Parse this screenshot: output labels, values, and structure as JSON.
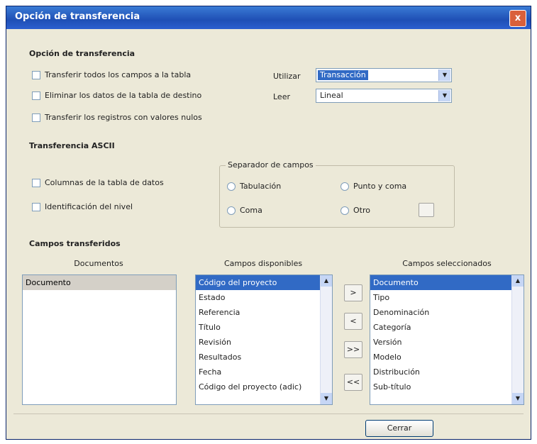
{
  "window": {
    "title": "Opción de transferencia",
    "close_label": "x"
  },
  "options_section": {
    "title": "Opción de transferencia",
    "checks": [
      {
        "label": "Transferir todos los campos a la tabla"
      },
      {
        "label": "Eliminar los datos de la tabla de destino"
      },
      {
        "label": "Transferir los registros con valores nulos"
      }
    ],
    "selects": [
      {
        "label": "Utilizar",
        "value": "Transacción"
      },
      {
        "label": "Leer",
        "value": "Lineal"
      }
    ]
  },
  "ascii_section": {
    "title": "Transferencia ASCII",
    "checks": [
      {
        "label": "Columnas de la tabla de datos"
      },
      {
        "label": "Identificación del nivel"
      }
    ],
    "separator_group": {
      "title": "Separador de campos",
      "options": [
        {
          "label": "Tabulación"
        },
        {
          "label": "Punto y coma"
        },
        {
          "label": "Coma"
        },
        {
          "label": "Otro"
        }
      ]
    }
  },
  "fields_section": {
    "title": "Campos transferidos",
    "col_heads": [
      "Documentos",
      "Campos disponibles",
      "Campos seleccionados"
    ],
    "documents": [
      "Documento"
    ],
    "available": [
      "Código del proyecto",
      "Estado",
      "Referencia",
      "Título",
      "Revisión",
      "Resultados",
      "Fecha",
      "Código del proyecto (adic)"
    ],
    "selected": [
      "Documento",
      "Tipo",
      "Denominación",
      "Categoría",
      "Versión",
      "Modelo",
      "Distribución",
      "Sub-título"
    ],
    "move_buttons": [
      ">",
      "<",
      ">>",
      "<<"
    ]
  },
  "ok_label": "Cerrar"
}
